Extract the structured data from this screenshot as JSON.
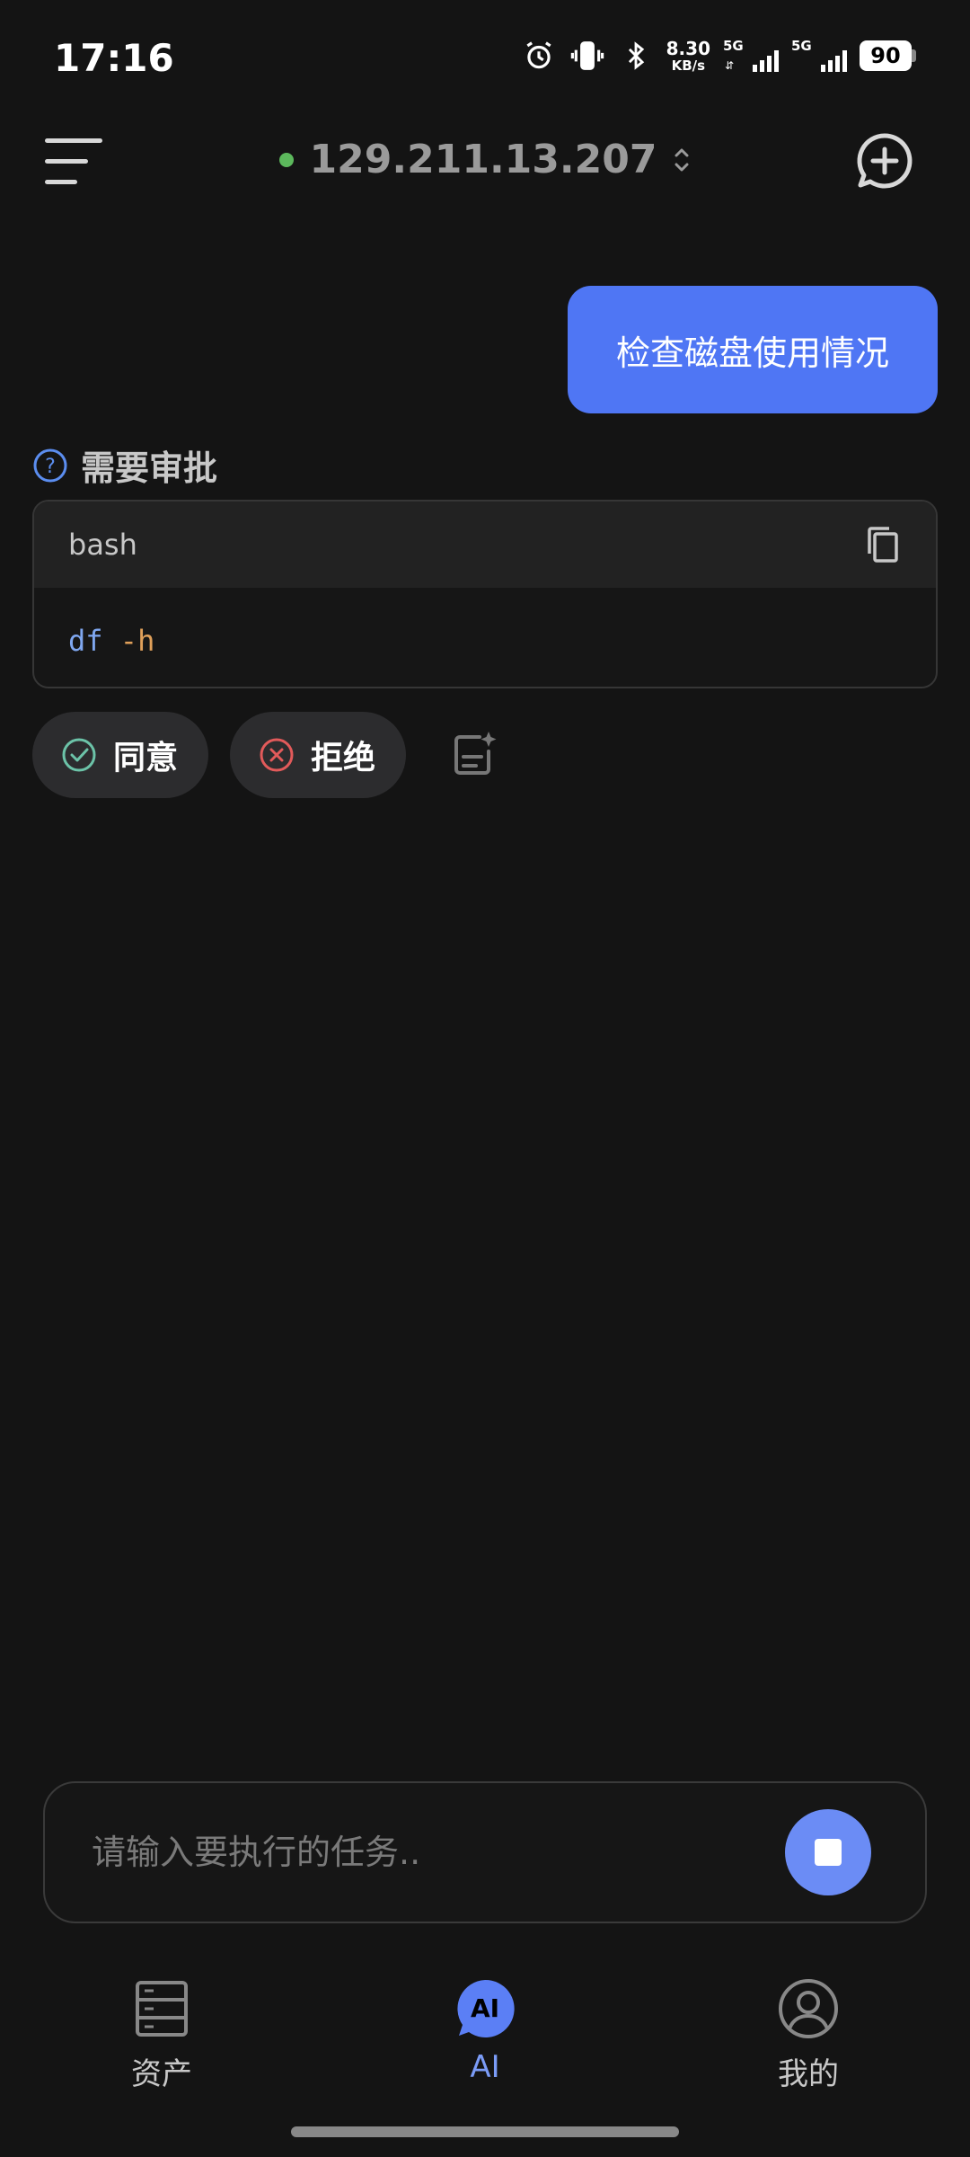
{
  "status_bar": {
    "time": "17:16",
    "net_speed_value": "8.30",
    "net_speed_unit": "KB/s",
    "sim1_label": "5G",
    "sim2_label": "5G",
    "battery": "90"
  },
  "header": {
    "server_ip": "129.211.13.207",
    "server_status_color": "#5cb85c"
  },
  "chat": {
    "user_message": "检查磁盘使用情况",
    "approval": {
      "title": "需要审批",
      "code_language": "bash",
      "command": "df",
      "args": " -h"
    },
    "actions": {
      "approve_label": "同意",
      "reject_label": "拒绝"
    }
  },
  "input": {
    "placeholder": "请输入要执行的任务.."
  },
  "nav": {
    "assets_label": "资产",
    "ai_label": "AI",
    "ai_badge": "AI",
    "mine_label": "我的"
  },
  "colors": {
    "accent": "#4f76f4",
    "approve": "#6cc3a8",
    "reject": "#e25a5a"
  }
}
